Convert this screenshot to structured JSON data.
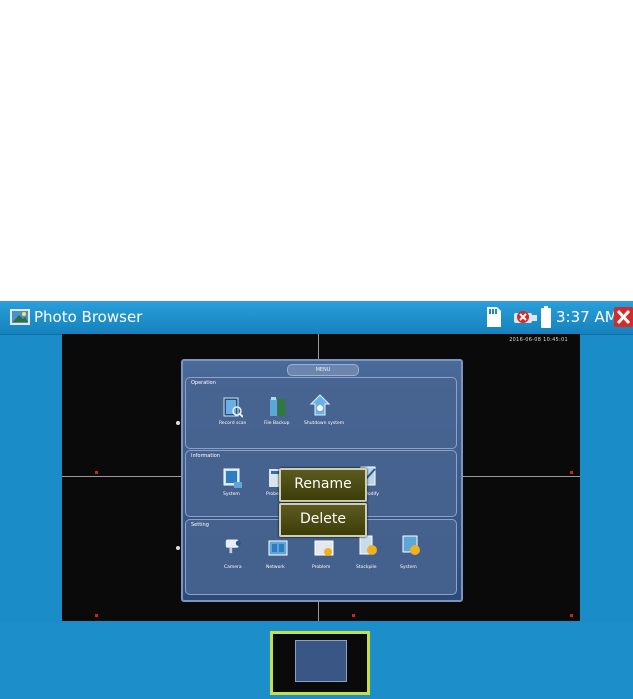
{
  "titlebar": {
    "title": "Photo Browser",
    "time": "3:37 AM",
    "icons": [
      "photo-browser-app-icon",
      "sd-card-icon",
      "usb-disconnected-icon",
      "battery-icon",
      "close-icon"
    ]
  },
  "photo": {
    "timestamp": "2016-06-08 10:45:01"
  },
  "menu": {
    "title": "MENU",
    "sections": [
      {
        "title": "Operation",
        "items": [
          "Record scan",
          "File Backup",
          "Shutdown system"
        ]
      },
      {
        "title": "Information",
        "items": [
          "System",
          "Probe",
          "",
          "Modify"
        ]
      },
      {
        "title": "Setting",
        "items": [
          "Camera",
          "Network",
          "Problem",
          "Stockpile",
          "System"
        ]
      }
    ]
  },
  "context_menu": {
    "rename": "Rename",
    "delete": "Delete"
  },
  "colors": {
    "titlebar": "#1a8cc8",
    "button": "#4a4a12",
    "thumb_border": "#c8df44"
  }
}
